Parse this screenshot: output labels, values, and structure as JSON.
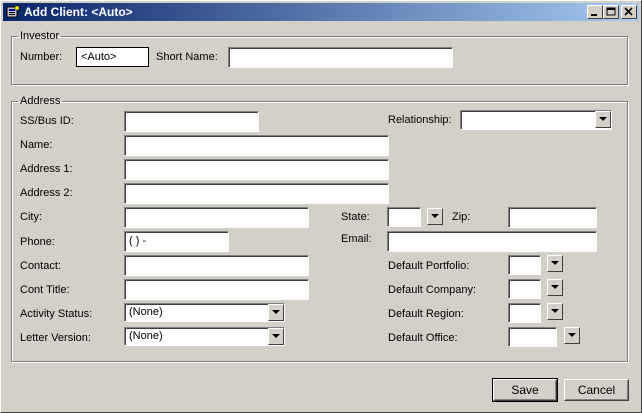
{
  "window": {
    "title": "Add Client: <Auto>",
    "controls": {
      "minimize": "minimize-icon",
      "maximize": "maximize-icon",
      "close": "close-icon"
    }
  },
  "investor": {
    "legend": "Investor",
    "number_label": "Number:",
    "number_value": "<Auto>",
    "short_name_label": "Short Name:",
    "short_name_value": ""
  },
  "address": {
    "legend": "Address",
    "ssbus_label": "SS/Bus ID:",
    "name_label": "Name:",
    "address1_label": "Address 1:",
    "address2_label": "Address 2:",
    "city_label": "City:",
    "phone_label": "Phone:",
    "phone_value": "(   )   -",
    "contact_label": "Contact:",
    "cont_title_label": "Cont Title:",
    "activity_status_label": "Activity Status:",
    "activity_status_value": "(None)",
    "letter_version_label": "Letter Version:",
    "letter_version_value": "(None)",
    "relationship_label": "Relationship:",
    "relationship_value": "",
    "state_label": "State:",
    "zip_label": "Zip:",
    "email_label": "Email:",
    "default_portfolio_label": "Default Portfolio:",
    "default_company_label": "Default Company:",
    "default_region_label": "Default Region:",
    "default_office_label": "Default Office:"
  },
  "buttons": {
    "save": "Save",
    "cancel": "Cancel"
  }
}
